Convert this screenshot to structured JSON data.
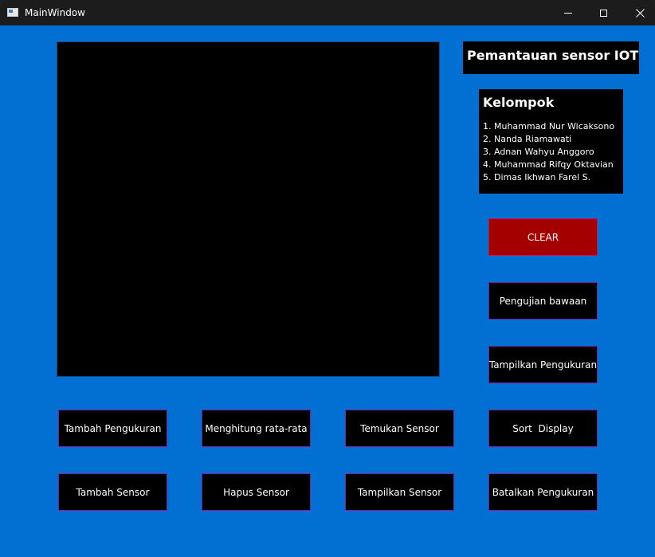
{
  "window": {
    "title": "MainWindow"
  },
  "header": {
    "title": "Pemantauan sensor IOT"
  },
  "group": {
    "heading": "Kelompok",
    "members": [
      "1. Muhammad Nur Wicaksono",
      "2. Nanda Riamawati",
      "3. Adnan Wahyu Anggoro",
      "4. Muhammad Rifqy Oktavian",
      "5. Dimas Ikhwan Farel S."
    ]
  },
  "side_buttons": {
    "clear": "CLEAR",
    "default_test": "Pengujian bawaan",
    "show_measurement": "Tampilkan Pengukuran"
  },
  "row1_buttons": {
    "add_measurement": "Tambah Pengukuran",
    "compute_average": "Menghitung rata-rata",
    "find_sensor": "Temukan Sensor",
    "sort_display": "Sort  Display"
  },
  "row2_buttons": {
    "add_sensor": "Tambah Sensor",
    "delete_sensor": "Hapus Sensor",
    "show_sensor": "Tampilkan Sensor",
    "cancel_measurement": "Batalkan Pengukuran"
  },
  "colors": {
    "background": "#0170d2",
    "panel": "#000000",
    "clear_button": "#a50000",
    "button_border": "#7a1fa2",
    "titlebar": "#1c1c1c"
  },
  "icons": {
    "app": "app-window-icon",
    "minimize": "minimize-icon",
    "maximize": "maximize-icon",
    "close": "close-icon"
  }
}
